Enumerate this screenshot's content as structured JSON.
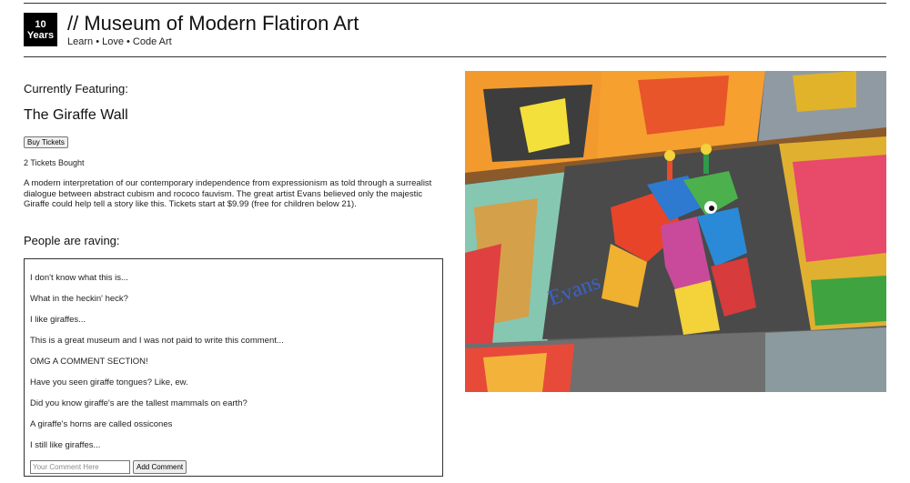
{
  "header": {
    "badge_line1": "10",
    "badge_line2": "Years",
    "title": "// Museum of Modern Flatiron Art",
    "tagline": "Learn • Love • Code Art"
  },
  "exhibit": {
    "featuring_label": "Currently Featuring:",
    "title": "The Giraffe Wall",
    "buy_button_label": "Buy Tickets",
    "tickets_bought": "2 Tickets Bought",
    "description": "A modern interpretation of our contemporary independence from expressionism as told through a surrealist dialogue between abstract cubism and rococo fauvism. The great artist Evans believed only the majestic Giraffe could help tell a story like this. Tickets start at $9.99 (free for children below 21).",
    "image_signature": "Evans"
  },
  "comments": {
    "heading": "People are raving:",
    "items": [
      "I don't know what this is...",
      "What in the heckin' heck?",
      "I like giraffes...",
      "This is a great museum and I was not paid to write this comment...",
      "OMG A COMMENT SECTION!",
      "Have you seen giraffe tongues? Like, ew.",
      "Did you know giraffe's are the tallest mammals on earth?",
      "A giraffe's horns are called ossicones",
      "I still like giraffes..."
    ],
    "input_placeholder": "Your Comment Here",
    "add_button_label": "Add Comment"
  }
}
